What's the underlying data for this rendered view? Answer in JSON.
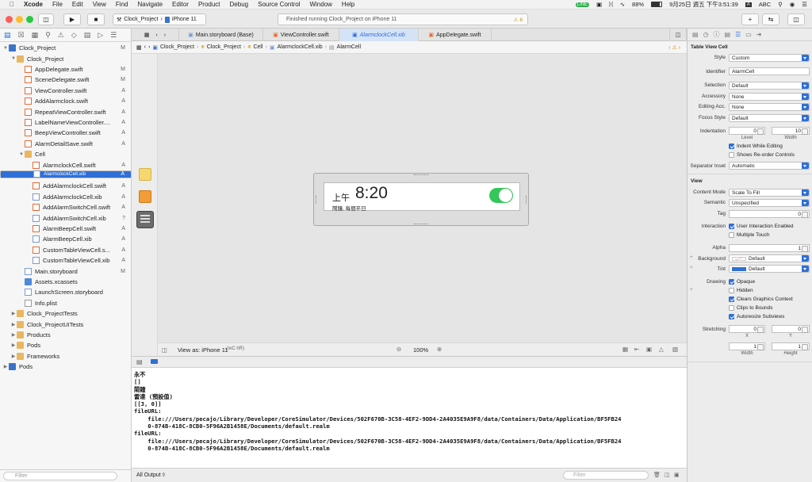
{
  "menubar": {
    "app": "Xcode",
    "items": [
      "File",
      "Edit",
      "View",
      "Find",
      "Navigate",
      "Editor",
      "Product",
      "Debug",
      "Source Control",
      "Window",
      "Help"
    ],
    "battery": "88%",
    "datetime": "9月25日 週五 下午3:51:39",
    "input": "ABC"
  },
  "toolbar": {
    "scheme": "Clock_Project",
    "device": "iPhone 11",
    "status": "Finished running Clock_Project on iPhone 11",
    "warnings": "8"
  },
  "navigator": {
    "filter_placeholder": "Filter",
    "rows": [
      {
        "name": "Clock_Project",
        "level": 0,
        "icon": "proj",
        "open": true,
        "status": "M"
      },
      {
        "name": "Clock_Project",
        "level": 1,
        "icon": "folder",
        "open": true,
        "status": ""
      },
      {
        "name": "AppDelegate.swift",
        "level": 2,
        "icon": "swift",
        "status": "M"
      },
      {
        "name": "SceneDelegate.swift",
        "level": 2,
        "icon": "swift",
        "status": "M"
      },
      {
        "name": "ViewController.swift",
        "level": 2,
        "icon": "swift",
        "status": "A"
      },
      {
        "name": "AddAlarmclock.swift",
        "level": 2,
        "icon": "swift",
        "status": "A"
      },
      {
        "name": "RepeatViewController.swift",
        "level": 2,
        "icon": "swift",
        "status": "A"
      },
      {
        "name": "LabelNameViewController....",
        "level": 2,
        "icon": "swift",
        "status": "A"
      },
      {
        "name": "BeepViewController.swift",
        "level": 2,
        "icon": "swift",
        "status": "A"
      },
      {
        "name": "AlarmDetailSave.swift",
        "level": 2,
        "icon": "swift",
        "status": "A"
      },
      {
        "name": "Cell",
        "level": 2,
        "icon": "folder",
        "open": true,
        "status": ""
      },
      {
        "name": "AlarmclockCell.swift",
        "level": 3,
        "icon": "swift",
        "status": "A"
      },
      {
        "name": "AlarmclockCell.xib",
        "level": 3,
        "icon": "xib",
        "status": "A",
        "selected": true
      },
      {
        "name": "AddAlarmclockCell.swift",
        "level": 3,
        "icon": "swift",
        "status": "A"
      },
      {
        "name": "AddAlarmclockCell.xib",
        "level": 3,
        "icon": "xib",
        "status": "A"
      },
      {
        "name": "AddAlarmSwitchCell.swift",
        "level": 3,
        "icon": "swift",
        "status": "A"
      },
      {
        "name": "AddAlarmSwitchCell.xib",
        "level": 3,
        "icon": "xib",
        "status": "?"
      },
      {
        "name": "AlarmBeepCell.swift",
        "level": 3,
        "icon": "swift",
        "status": "A"
      },
      {
        "name": "AlarmBeepCell.xib",
        "level": 3,
        "icon": "xib",
        "status": "A"
      },
      {
        "name": "CustomTableViewCell.s...",
        "level": 3,
        "icon": "swift",
        "status": "A"
      },
      {
        "name": "CustomTableViewCell.xib",
        "level": 3,
        "icon": "xib",
        "status": "A"
      },
      {
        "name": "Main.storyboard",
        "level": 2,
        "icon": "xib",
        "status": "M"
      },
      {
        "name": "Assets.xcassets",
        "level": 2,
        "icon": "assets",
        "status": ""
      },
      {
        "name": "LaunchScreen.storyboard",
        "level": 2,
        "icon": "xib",
        "status": ""
      },
      {
        "name": "Info.plist",
        "level": 2,
        "icon": "plist",
        "status": ""
      },
      {
        "name": "Clock_ProjectTests",
        "level": 1,
        "icon": "folder",
        "open": false,
        "status": ""
      },
      {
        "name": "Clock_ProjectUITests",
        "level": 1,
        "icon": "folder",
        "open": false,
        "status": ""
      },
      {
        "name": "Products",
        "level": 1,
        "icon": "folder",
        "open": false,
        "status": ""
      },
      {
        "name": "Pods",
        "level": 1,
        "icon": "folder",
        "open": false,
        "status": ""
      },
      {
        "name": "Frameworks",
        "level": 1,
        "icon": "folder",
        "open": false,
        "status": ""
      },
      {
        "name": "Pods",
        "level": 0,
        "icon": "proj",
        "open": false,
        "status": ""
      }
    ]
  },
  "tabs": [
    {
      "label": "Main.storyboard (Base)",
      "active": false
    },
    {
      "label": "ViewController.swift",
      "active": false
    },
    {
      "label": "AlarmclockCell.xib",
      "active": true
    },
    {
      "label": "AppDelegate.swift",
      "active": false
    }
  ],
  "jumpbar": [
    "Clock_Project",
    "Clock_Project",
    "Cell",
    "AlarmclockCell.xib",
    "AlarmCell"
  ],
  "canvas": {
    "ampm": "上午",
    "time": "8:20",
    "subtitle": "鬧鐘, 每個平日",
    "switch_on": true,
    "view_as": "View as: iPhone 11",
    "view_as_suffix": "(wC hR)",
    "zoom": "100%"
  },
  "console": {
    "lines": [
      "永不",
      "[]",
      "鬧鐘",
      "雷達 (預設值)",
      "[[3, 0]]",
      "fileURL:",
      "    file:///Users/pecajo/Library/Developer/CoreSimulator/Devices/502F670B-3C58-4EF2-9DD4-2A4035E9A9F8/data/Containers/Data/Application/BF5FB24",
      "    0-874B-418C-8CB0-5F96A2B1458E/Documents/default.realm",
      "fileURL:",
      "    file:///Users/pecajo/Library/Developer/CoreSimulator/Devices/502F670B-3C58-4EF2-9DD4-2A4035E9A9F8/data/Containers/Data/Application/BF5FB24",
      "    0-874B-418C-8CB0-5F96A2B1458E/Documents/default.realm"
    ],
    "output_selector": "All Output ◊",
    "filter_placeholder": "Filter"
  },
  "inspector": {
    "section1": "Table View Cell",
    "style_label": "Style",
    "style": "Custom",
    "identifier_label": "Identifier",
    "identifier": "AlarmCell",
    "selection_label": "Selection",
    "selection": "Default",
    "accessory_label": "Accessory",
    "accessory": "None",
    "editing_acc_label": "Editing Acc.",
    "editing_acc": "None",
    "focus_label": "Focus Style",
    "focus": "Default",
    "indentation_label": "Indentation",
    "level_value": "0",
    "width_value": "10",
    "level_caption": "Level",
    "width_caption": "Width",
    "indent_editing": "Indent While Editing",
    "reorder": "Shows Re-order Controls",
    "sep_label": "Separator Inset",
    "sep": "Automatic",
    "section2": "View",
    "content_mode_label": "Content Mode",
    "content_mode": "Scale To Fill",
    "semantic_label": "Semantic",
    "semantic": "Unspecified",
    "tag_label": "Tag",
    "tag": "0",
    "interaction_label": "Interaction",
    "user_interaction": "User Interaction Enabled",
    "multiple_touch": "Multiple Touch",
    "alpha_label": "Alpha",
    "alpha": "1",
    "background_label": "Background",
    "background": "Default",
    "tint_label": "Tint",
    "tint": "Default",
    "drawing_label": "Drawing",
    "opaque": "Opaque",
    "hidden": "Hidden",
    "clears": "Clears Graphics Context",
    "clips": "Clips to Bounds",
    "autoresize": "Autoresize Subviews",
    "stretching_label": "Stretching",
    "x_value": "0",
    "y_value": "0",
    "w_value": "1",
    "h_value": "1",
    "x_caption": "X",
    "y_caption": "Y",
    "w_caption": "Width",
    "h_caption": "Height"
  }
}
